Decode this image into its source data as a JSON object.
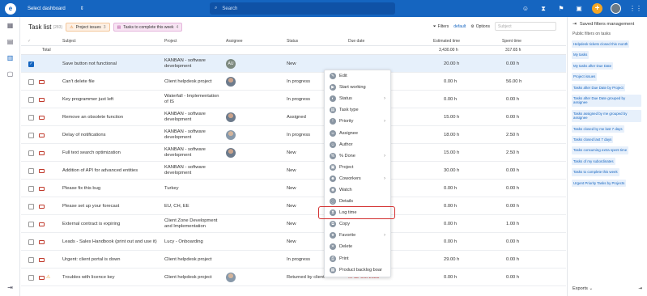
{
  "topbar": {
    "dashboard_label": "Select dashboard",
    "search_placeholder": "Search"
  },
  "list": {
    "title": "Task list",
    "count": "(283)",
    "chips": [
      {
        "label": "Project issues",
        "count": "3"
      },
      {
        "label": "Tasks to complete this week",
        "count": "4"
      }
    ],
    "filters_label": "Filters",
    "default_label": "default",
    "options_label": "Options",
    "subject_placeholder": "Subject"
  },
  "table": {
    "headers": {
      "subject": "Subject",
      "project": "Project",
      "assignee": "Assignee",
      "status": "Status",
      "due_date": "Due date",
      "estimated": "Estimated time",
      "spent": "Spent time"
    },
    "total": {
      "label": "Total",
      "estimated": "3,430.00 h",
      "spent": "317.65 h"
    },
    "rows": [
      {
        "subject": "Save button not functional",
        "project": "KANBAN - software development",
        "assignee": "AU",
        "status": "New",
        "due": "",
        "est": "20.00 h",
        "spent": "0.00 h"
      },
      {
        "subject": "Can't delete file",
        "project": "Client helpdesk project",
        "assignee": "photo",
        "status": "In progress",
        "due": "",
        "est": "0.00 h",
        "spent": "56.00 h"
      },
      {
        "subject": "Key programmer just left",
        "project": "Waterfall - Implementation of IS",
        "assignee": "",
        "status": "In progress",
        "due": "",
        "est": "0.00 h",
        "spent": "0.00 h"
      },
      {
        "subject": "Remove an obsolete function",
        "project": "KANBAN - software development",
        "assignee": "photo",
        "status": "Assigned",
        "due": "",
        "est": "15.00 h",
        "spent": "0.00 h"
      },
      {
        "subject": "Delay of notifications",
        "project": "KANBAN - software development",
        "assignee": "photo",
        "status": "In progress",
        "due": "",
        "est": "18.00 h",
        "spent": "2.50 h"
      },
      {
        "subject": "Full text search optimization",
        "project": "KANBAN - software development",
        "assignee": "photo",
        "status": "New",
        "due": "",
        "est": "15.00 h",
        "spent": "2.50 h"
      },
      {
        "subject": "Addition of API for advanced entities",
        "project": "KANBAN - software development",
        "assignee": "",
        "status": "New",
        "due": "",
        "est": "30.00 h",
        "spent": "0.00 h"
      },
      {
        "subject": "Please fix this bug",
        "project": "Turkey",
        "assignee": "",
        "status": "New",
        "due": "",
        "est": "0.00 h",
        "spent": "0.00 h"
      },
      {
        "subject": "Please set up your forecast",
        "project": "EU, CH, EE",
        "assignee": "",
        "status": "New",
        "due": "",
        "est": "0.00 h",
        "spent": "0.00 h"
      },
      {
        "subject": "External contract is expiring",
        "project": "Client Zone Development and Implementation",
        "assignee": "",
        "status": "New",
        "due": "",
        "est": "0.00 h",
        "spent": "1.00 h"
      },
      {
        "subject": "Leads - Sales Handbook (print out and use it)",
        "project": "Lucy - Onboarding",
        "assignee": "",
        "status": "New",
        "due": "",
        "est": "0.00 h",
        "spent": "0.00 h"
      },
      {
        "subject": "Urgent: client portal is down",
        "project": "Client helpdesk project",
        "assignee": "",
        "status": "In progress",
        "due": "",
        "est": "29.00 h",
        "spent": "0.00 h"
      },
      {
        "subject": "Troubles with licence key",
        "project": "Client helpdesk project",
        "assignee": "photo",
        "status": "Returned by client",
        "due": "12 Oct 2023",
        "est": "0.00 h",
        "spent": "0.00 h"
      }
    ]
  },
  "context_menu": {
    "items": [
      {
        "label": "Edit",
        "arrow": false
      },
      {
        "label": "Start working",
        "arrow": false
      },
      {
        "label": "Status",
        "arrow": true
      },
      {
        "label": "Task type",
        "arrow": false
      },
      {
        "label": "Priority",
        "arrow": true
      },
      {
        "label": "Assignee",
        "arrow": false
      },
      {
        "label": "Author",
        "arrow": false
      },
      {
        "label": "% Done",
        "arrow": true
      },
      {
        "label": "Project",
        "arrow": false
      },
      {
        "label": "Coworkers",
        "arrow": true
      },
      {
        "label": "Watch",
        "arrow": false
      },
      {
        "label": "Details",
        "arrow": false
      },
      {
        "label": "Log time",
        "arrow": false
      },
      {
        "label": "Copy",
        "arrow": false
      },
      {
        "label": "Favorite",
        "arrow": true
      },
      {
        "label": "Delete",
        "arrow": false
      },
      {
        "label": "Print",
        "arrow": false
      },
      {
        "label": "Product backlog boar",
        "arrow": false
      }
    ]
  },
  "right_panel": {
    "title": "Saved filters management",
    "subtitle": "Public filters on tasks",
    "filters": [
      "Helpdesk tickets closed this month",
      "My tasks",
      "My tasks after Due Date",
      "Project issues",
      "Tasks after Due Date by Project",
      "Tasks after Due Date grouped by assignee",
      "Tasks assigned by me grouped by assignee",
      "Tasks closed by me last 7 days",
      "Tasks closed last 7 days",
      "Tasks consuming extra spent time",
      "Tasks of my subordinates",
      "Tasks to complete this week",
      "Urgent Priority Tasks by Projects"
    ],
    "exports_label": "Exports"
  }
}
